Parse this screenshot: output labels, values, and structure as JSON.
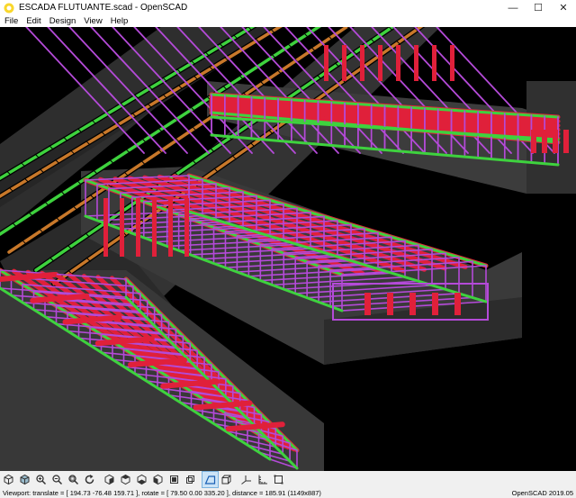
{
  "window": {
    "title": "ESCADA FLUTUANTE.scad - OpenSCAD",
    "minimize": "—",
    "maximize": "☐",
    "close": "✕"
  },
  "menu": [
    "File",
    "Edit",
    "Design",
    "View",
    "Help"
  ],
  "toolbar": {
    "buttons": [
      "render-preview",
      "render",
      "zoom-in",
      "zoom-out",
      "zoom-all",
      "reset-view",
      "view-right",
      "view-top",
      "view-bottom",
      "view-left",
      "view-front",
      "view-back",
      "perspective",
      "orthogonal",
      "show-axes",
      "show-scale",
      "show-edges"
    ],
    "active": "perspective"
  },
  "status": {
    "viewport": "Viewport: translate = [ 194.73 -76.48 159.71 ], rotate = [ 79.50 0.00 335.20 ], distance = 185.91 (1149x887)",
    "version": "OpenSCAD 2019.05"
  },
  "colors": {
    "rebar_red": "#e0203a",
    "stirrup": "#b44ad8",
    "green_bar": "#3ed23e",
    "orange_bar": "#c8782a",
    "concrete": "#3a3a3a",
    "background": "#000000"
  }
}
